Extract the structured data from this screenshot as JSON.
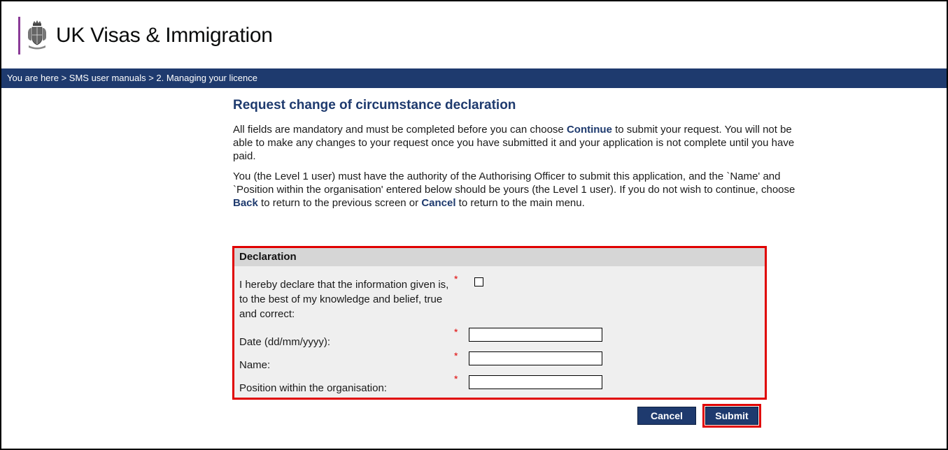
{
  "header": {
    "brand": "UK Visas & Immigration",
    "accent_color": "#8a3b97",
    "crest_icon": "royal-crest-icon"
  },
  "breadcrumb": {
    "text": "You are here > SMS user manuals > 2. Managing your licence",
    "bar_color": "#1e3a6e"
  },
  "main": {
    "title": "Request change of circumstance declaration",
    "para1": {
      "before": "All fields are mandatory and must be completed before you can choose ",
      "bold": "Continue",
      "after": " to submit your request. You will not be able to make any changes to your request once you have submitted it and your application is not complete until you have paid."
    },
    "para2": {
      "part1": "You (the Level 1 user) must have the authority of the Authorising Officer to submit this application, and the `Name' and `Position within the organisation' entered below should be yours (the Level 1 user). If you do not wish to continue, choose ",
      "back": "Back",
      "part2": " to return to the previous screen or ",
      "cancel": "Cancel",
      "part3": " to return to the main menu."
    }
  },
  "declaration": {
    "heading": "Declaration",
    "required_marker": "*",
    "declare_label": "I hereby declare that the information given is, to the best of my knowledge and belief, true and correct:",
    "declare_checked": false,
    "date_label": "Date (dd/mm/yyyy):",
    "date_value": "",
    "name_label": "Name:",
    "name_value": "",
    "position_label": "Position within the organisation:",
    "position_value": "",
    "highlight_color": "#e00000"
  },
  "actions": {
    "cancel_label": "Cancel",
    "submit_label": "Submit"
  }
}
